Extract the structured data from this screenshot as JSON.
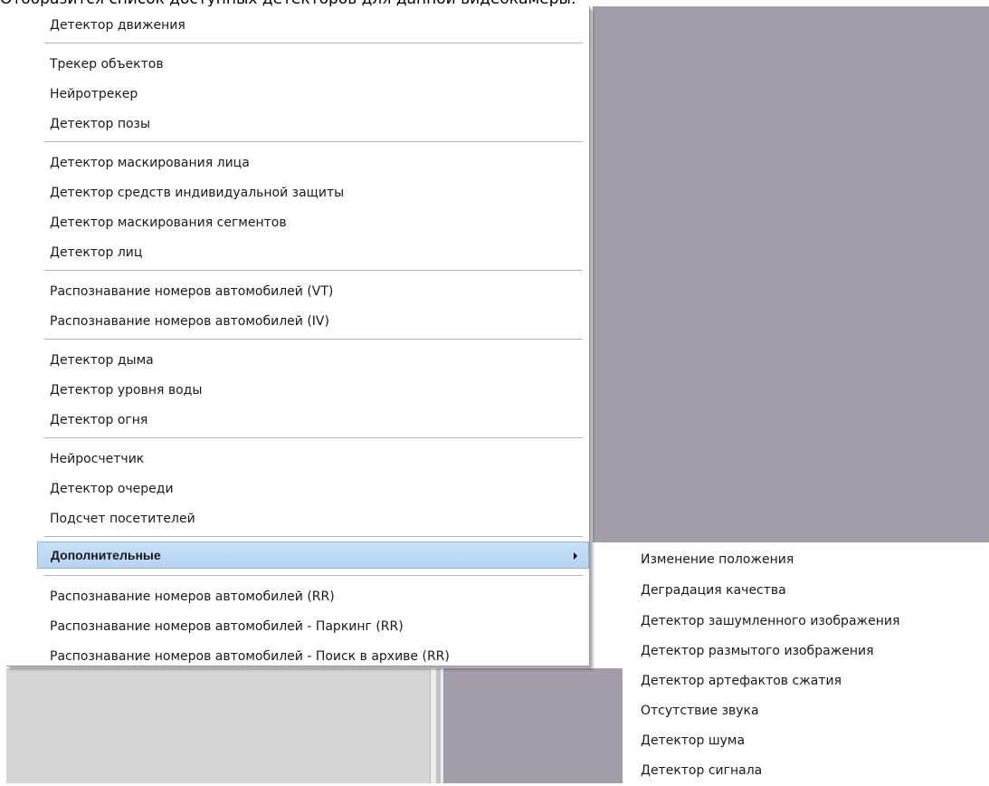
{
  "caption": "Отобразится список доступных детекторов для данной видеокамеры.",
  "colors": {
    "video_background": "#a49ca8",
    "highlight": "#b6d4f2",
    "highlight_border": "#8db4dd"
  },
  "menu": {
    "groups": [
      {
        "items": [
          "Детектор движения"
        ]
      },
      {
        "items": [
          "Трекер объектов",
          "Нейротрекер",
          "Детектор позы"
        ]
      },
      {
        "items": [
          "Детектор маскирования лица",
          "Детектор средств индивидуальной защиты",
          "Детектор маскирования сегментов",
          "Детектор лиц"
        ]
      },
      {
        "items": [
          "Распознавание номеров автомобилей (VT)",
          "Распознавание номеров автомобилей (IV)"
        ]
      },
      {
        "items": [
          "Детектор дыма",
          "Детектор уровня воды",
          "Детектор огня"
        ]
      },
      {
        "items": [
          "Нейросчетчик",
          "Детектор очереди",
          "Подсчет посетителей"
        ]
      },
      {
        "items": [
          "Дополнительные"
        ],
        "highlighted": true,
        "has_submenu": true
      },
      {
        "items": [
          "Распознавание номеров автомобилей (RR)",
          "Распознавание номеров автомобилей - Паркинг (RR)",
          "Распознавание номеров автомобилей - Поиск в архиве (RR)"
        ]
      }
    ]
  },
  "submenu": {
    "items": [
      "Изменение положения",
      "Деградация качества",
      "Детектор зашумленного изображения",
      "Детектор размытого изображения",
      "Детектор артефактов сжатия",
      "Отсутствие звука",
      "Детектор шума",
      "Детектор сигнала"
    ]
  }
}
